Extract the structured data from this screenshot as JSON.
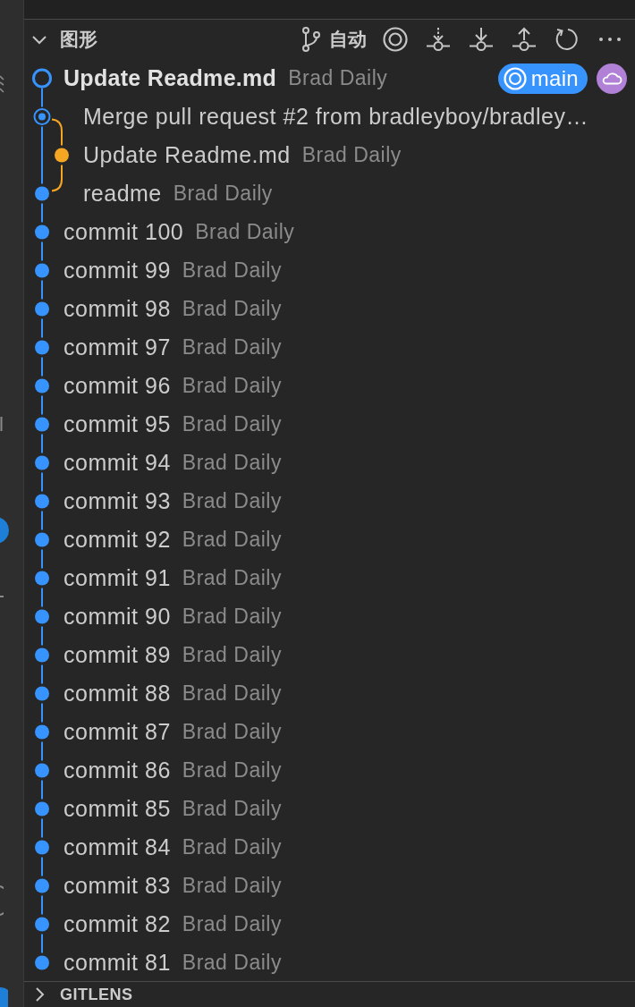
{
  "graph_panel": {
    "title": "图形",
    "expanded": true,
    "toolbar": {
      "branch_filter": "自动"
    }
  },
  "commits": [
    {
      "message": "Update Readme.md",
      "author": "Brad Daily",
      "kind": "head",
      "color": "#3794ff",
      "refs": [
        {
          "kind": "branch",
          "label": "main",
          "color": "#3794ff"
        },
        {
          "kind": "remote",
          "color": "#b180d7"
        }
      ]
    },
    {
      "message": "Merge pull request #2 from bradleyboy/bradley…",
      "kind": "merge",
      "color": "#3794ff"
    },
    {
      "message": "Update Readme.md",
      "author": "Brad Daily",
      "kind": "side",
      "color": "#f5a623"
    },
    {
      "message": "readme",
      "author": "Brad Daily",
      "kind": "commit",
      "color": "#3794ff"
    },
    {
      "message": "commit 100",
      "author": "Brad Daily",
      "kind": "commit",
      "color": "#3794ff"
    },
    {
      "message": "commit 99",
      "author": "Brad Daily",
      "kind": "commit",
      "color": "#3794ff"
    },
    {
      "message": "commit 98",
      "author": "Brad Daily",
      "kind": "commit",
      "color": "#3794ff"
    },
    {
      "message": "commit 97",
      "author": "Brad Daily",
      "kind": "commit",
      "color": "#3794ff"
    },
    {
      "message": "commit 96",
      "author": "Brad Daily",
      "kind": "commit",
      "color": "#3794ff"
    },
    {
      "message": "commit 95",
      "author": "Brad Daily",
      "kind": "commit",
      "color": "#3794ff"
    },
    {
      "message": "commit 94",
      "author": "Brad Daily",
      "kind": "commit",
      "color": "#3794ff"
    },
    {
      "message": "commit 93",
      "author": "Brad Daily",
      "kind": "commit",
      "color": "#3794ff"
    },
    {
      "message": "commit 92",
      "author": "Brad Daily",
      "kind": "commit",
      "color": "#3794ff"
    },
    {
      "message": "commit 91",
      "author": "Brad Daily",
      "kind": "commit",
      "color": "#3794ff"
    },
    {
      "message": "commit 90",
      "author": "Brad Daily",
      "kind": "commit",
      "color": "#3794ff"
    },
    {
      "message": "commit 89",
      "author": "Brad Daily",
      "kind": "commit",
      "color": "#3794ff"
    },
    {
      "message": "commit 88",
      "author": "Brad Daily",
      "kind": "commit",
      "color": "#3794ff"
    },
    {
      "message": "commit 87",
      "author": "Brad Daily",
      "kind": "commit",
      "color": "#3794ff"
    },
    {
      "message": "commit 86",
      "author": "Brad Daily",
      "kind": "commit",
      "color": "#3794ff"
    },
    {
      "message": "commit 85",
      "author": "Brad Daily",
      "kind": "commit",
      "color": "#3794ff"
    },
    {
      "message": "commit 84",
      "author": "Brad Daily",
      "kind": "commit",
      "color": "#3794ff"
    },
    {
      "message": "commit 83",
      "author": "Brad Daily",
      "kind": "commit",
      "color": "#3794ff"
    },
    {
      "message": "commit 82",
      "author": "Brad Daily",
      "kind": "commit",
      "color": "#3794ff"
    },
    {
      "message": "commit 81",
      "author": "Brad Daily",
      "kind": "commit",
      "color": "#3794ff"
    }
  ],
  "sections": [
    {
      "title": "GITLENS",
      "expanded": false
    }
  ]
}
